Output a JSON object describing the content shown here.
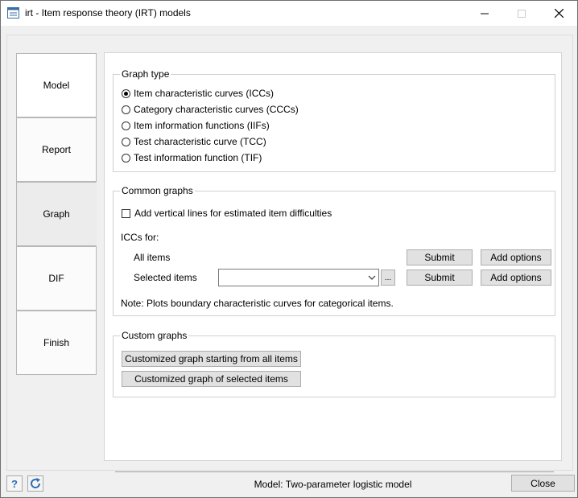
{
  "window": {
    "title": "irt - Item response theory (IRT) models"
  },
  "tabs": [
    {
      "label": "Model",
      "active": false
    },
    {
      "label": "Report",
      "active": false
    },
    {
      "label": "Graph",
      "active": true
    },
    {
      "label": "DIF",
      "active": false
    },
    {
      "label": "Finish",
      "active": false
    }
  ],
  "graph_type": {
    "legend": "Graph type",
    "options": [
      {
        "label": "Item characteristic curves (ICCs)",
        "selected": true
      },
      {
        "label": "Category characteristic curves (CCCs)",
        "selected": false
      },
      {
        "label": "Item information functions (IIFs)",
        "selected": false
      },
      {
        "label": "Test characteristic curve (TCC)",
        "selected": false
      },
      {
        "label": "Test information function (TIF)",
        "selected": false
      }
    ]
  },
  "common_graphs": {
    "legend": "Common graphs",
    "checkbox_label": "Add vertical lines for estimated item difficulties",
    "checkbox_checked": false,
    "iccs_for_label": "ICCs for:",
    "all_items_label": "All items",
    "selected_items_label": "Selected items",
    "selected_items_value": "",
    "browse_label": "...",
    "submit_label": "Submit",
    "add_options_label": "Add options",
    "note": "Note: Plots boundary characteristic curves for categorical items."
  },
  "custom_graphs": {
    "legend": "Custom graphs",
    "btn_all": "Customized graph starting from all items",
    "btn_selected": "Customized graph of selected items"
  },
  "status": {
    "model_text": "Model: Two-parameter logistic model"
  },
  "footer": {
    "close_label": "Close",
    "help_icon": "help-icon",
    "reset_icon": "refresh-icon"
  }
}
